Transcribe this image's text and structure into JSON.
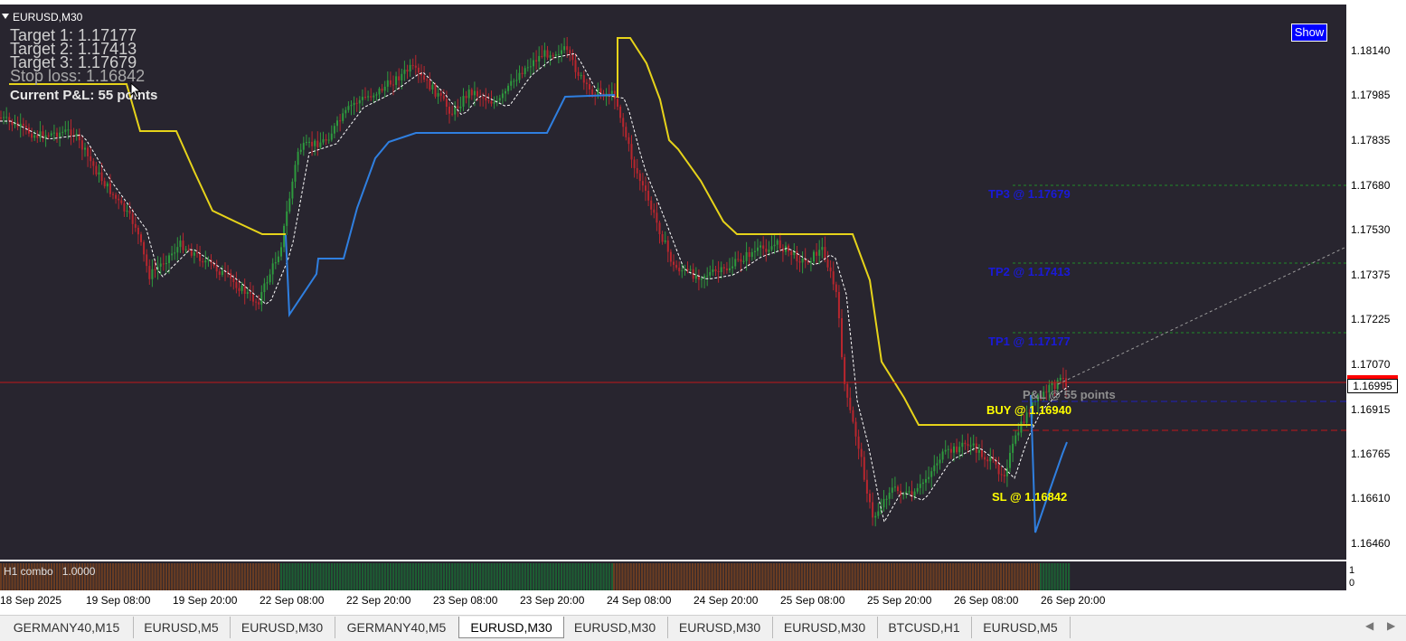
{
  "chart": {
    "symbol_label": "EURUSD,M30",
    "show_button": "Show",
    "info_panel": {
      "target1": "Target 1: 1.17177",
      "target2": "Target 2: 1.17413",
      "target3": "Target 3: 1.17679",
      "stop_loss": "Stop loss: 1.16842",
      "current_pnl": "Current P&L: 55 points"
    },
    "levels": {
      "tp3": "TP3 @ 1.17679",
      "tp2": "TP2 @ 1.17413",
      "tp1": "TP1 @ 1.17177",
      "pnl": "P&L @ 55 points",
      "buy": "BUY @ 1.16940",
      "sl": "SL @ 1.16842"
    },
    "current_price": "1.16995",
    "price_axis": [
      "1.18140",
      "1.17985",
      "1.17835",
      "1.17680",
      "1.17530",
      "1.17375",
      "1.17225",
      "1.17070",
      "1.16915",
      "1.16765",
      "1.16610",
      "1.16460"
    ],
    "time_axis": [
      "18 Sep 2025",
      "19 Sep 08:00",
      "19 Sep 20:00",
      "22 Sep 08:00",
      "22 Sep 20:00",
      "23 Sep 08:00",
      "23 Sep 20:00",
      "24 Sep 08:00",
      "24 Sep 20:00",
      "25 Sep 08:00",
      "25 Sep 20:00",
      "26 Sep 08:00",
      "26 Sep 20:00"
    ],
    "colors": {
      "background": "#28252f",
      "bull": "#2e9a3e",
      "bear": "#b8262e",
      "supertrend": "#e6d31a",
      "trail": "#2f7fe0",
      "ma": "#ffffff",
      "buy_label": "#ffff00",
      "tp_label": "#1010d0"
    }
  },
  "indicator": {
    "title": "H1 combo",
    "value": "1.0000",
    "axis_top": "1",
    "axis_bottom": "0"
  },
  "tabs": [
    {
      "label": "GERMANY40,M15"
    },
    {
      "label": "EURUSD,M5"
    },
    {
      "label": "EURUSD,M30"
    },
    {
      "label": "GERMANY40,M5"
    },
    {
      "label": "EURUSD,M30",
      "active": true
    },
    {
      "label": "EURUSD,M30"
    },
    {
      "label": "EURUSD,M30"
    },
    {
      "label": "EURUSD,M30"
    },
    {
      "label": "BTCUSD,H1"
    },
    {
      "label": "EURUSD,M5"
    }
  ],
  "scroll": {
    "left": "◀",
    "right": "▶"
  }
}
